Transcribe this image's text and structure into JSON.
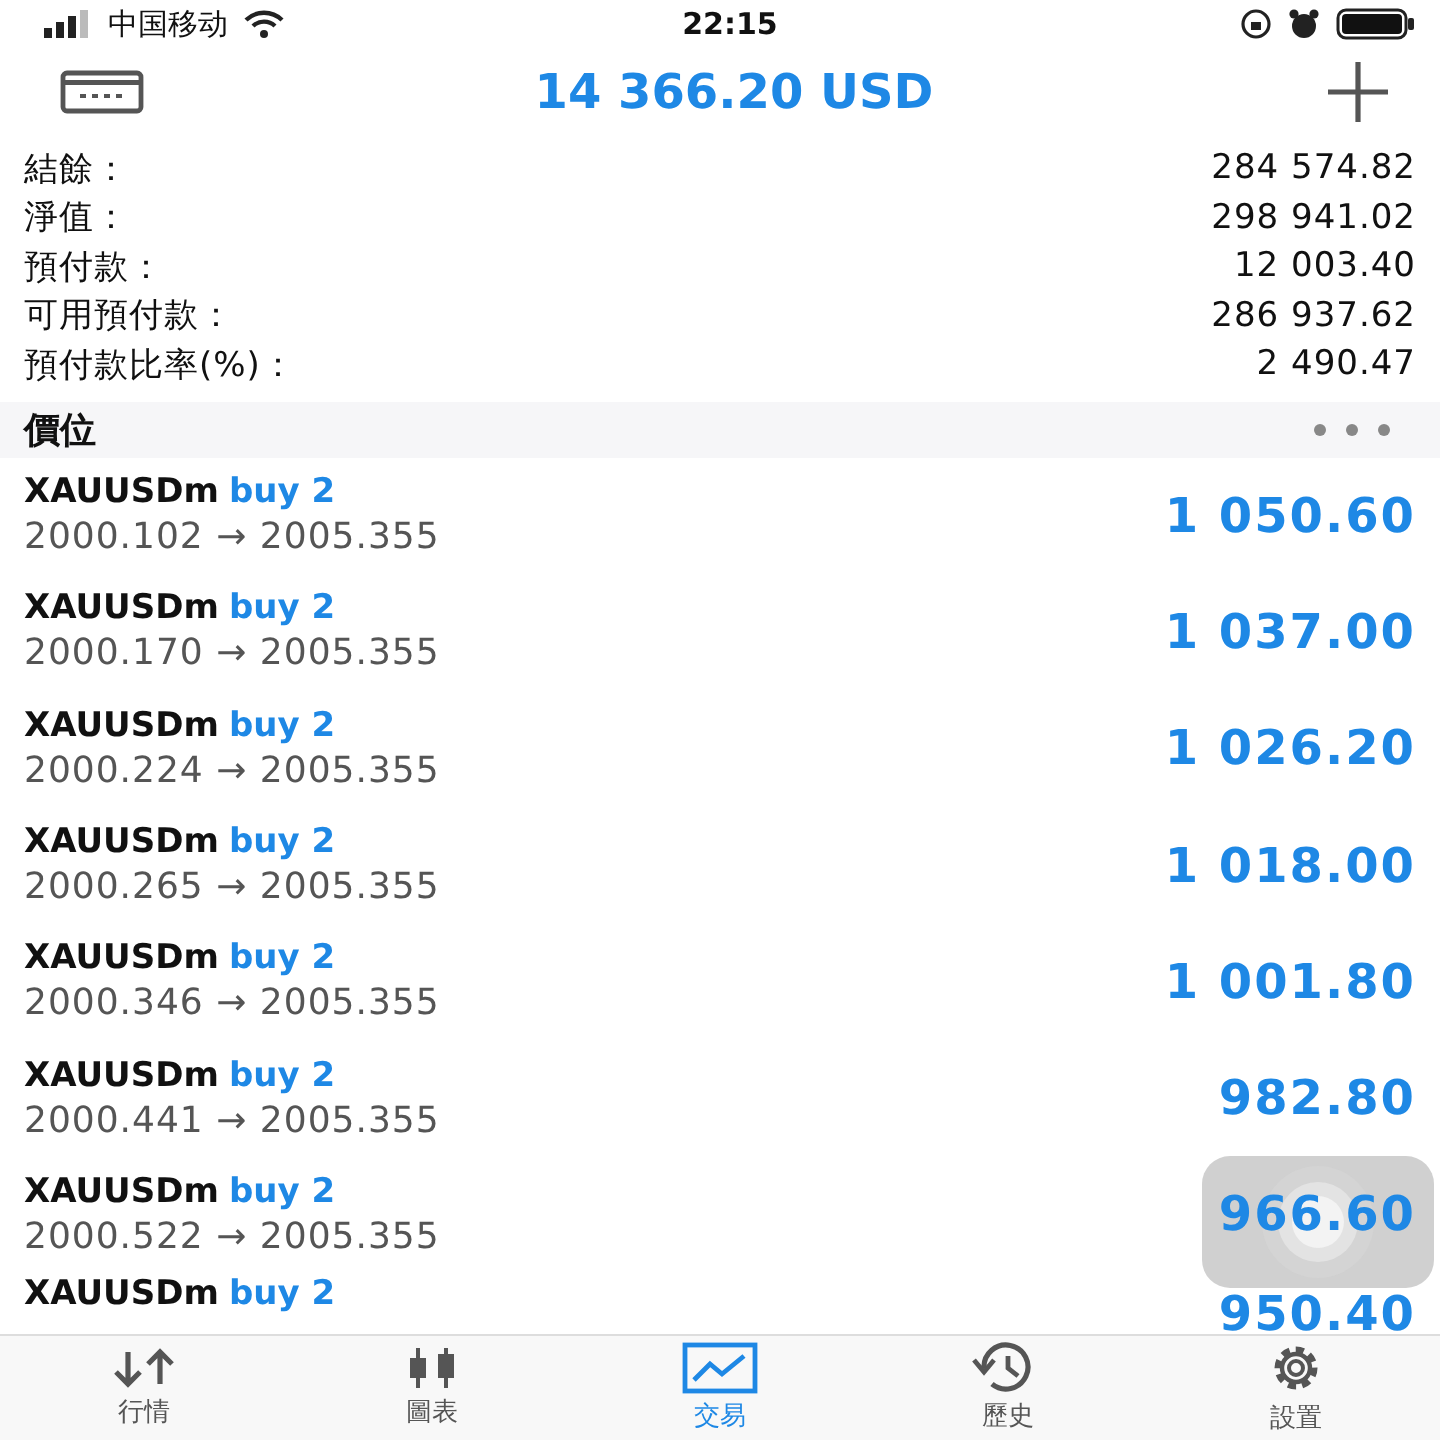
{
  "status_bar": {
    "carrier": "中国移动",
    "time": "22:15"
  },
  "header": {
    "balance": "14 366.20 USD"
  },
  "summary": [
    {
      "label": "結餘：",
      "value": "284 574.82"
    },
    {
      "label": "淨值：",
      "value": "298 941.02"
    },
    {
      "label": "預付款：",
      "value": "12 003.40"
    },
    {
      "label": "可用預付款：",
      "value": "286 937.62"
    },
    {
      "label": "預付款比率(%)：",
      "value": "2 490.47"
    }
  ],
  "section": {
    "title": "價位"
  },
  "positions": [
    {
      "symbol": "XAUUSDm",
      "side": "buy 2",
      "prices": "2000.102 → 2005.355",
      "profit": "1 050.60"
    },
    {
      "symbol": "XAUUSDm",
      "side": "buy 2",
      "prices": "2000.170 → 2005.355",
      "profit": "1 037.00"
    },
    {
      "symbol": "XAUUSDm",
      "side": "buy 2",
      "prices": "2000.224 → 2005.355",
      "profit": "1 026.20"
    },
    {
      "symbol": "XAUUSDm",
      "side": "buy 2",
      "prices": "2000.265 → 2005.355",
      "profit": "1 018.00"
    },
    {
      "symbol": "XAUUSDm",
      "side": "buy 2",
      "prices": "2000.346 → 2005.355",
      "profit": "1 001.80"
    },
    {
      "symbol": "XAUUSDm",
      "side": "buy 2",
      "prices": "2000.441 → 2005.355",
      "profit": "982.80"
    },
    {
      "symbol": "XAUUSDm",
      "side": "buy 2",
      "prices": "2000.522 → 2005.355",
      "profit": "966.60"
    },
    {
      "symbol": "XAUUSDm",
      "side": "buy 2",
      "profit": "950.40"
    }
  ],
  "tabs": [
    {
      "label": "行情",
      "kind": "quotes",
      "selected": false
    },
    {
      "label": "圖表",
      "kind": "chart",
      "selected": false
    },
    {
      "label": "交易",
      "kind": "trade",
      "selected": true
    },
    {
      "label": "歷史",
      "kind": "history",
      "selected": false
    },
    {
      "label": "設置",
      "kind": "settings",
      "selected": false
    }
  ]
}
